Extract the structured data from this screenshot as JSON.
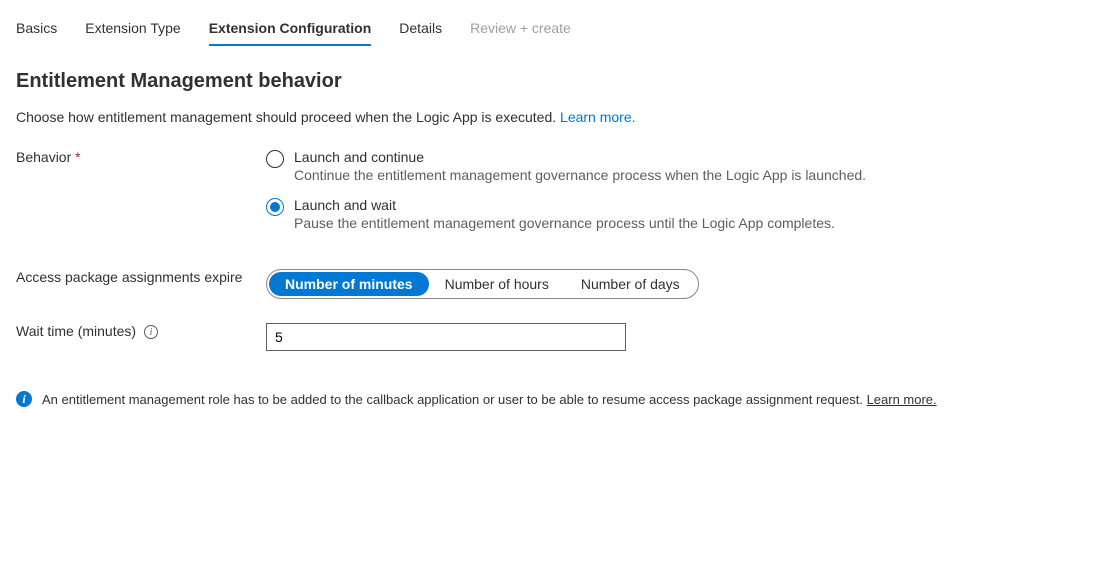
{
  "tabs": {
    "basics": "Basics",
    "extension_type": "Extension Type",
    "extension_configuration": "Extension Configuration",
    "details": "Details",
    "review_create": "Review + create"
  },
  "section_title": "Entitlement Management behavior",
  "description": "Choose how entitlement management should proceed when the Logic App is executed. ",
  "learn_more": "Learn more.",
  "behavior": {
    "label": "Behavior",
    "options": {
      "launch_continue": {
        "label": "Launch and continue",
        "desc": "Continue the entitlement management governance process when the Logic App is launched."
      },
      "launch_wait": {
        "label": "Launch and wait",
        "desc": "Pause the entitlement management governance process until the Logic App completes."
      }
    }
  },
  "expire": {
    "label": "Access package assignments expire",
    "options": {
      "minutes": "Number of minutes",
      "hours": "Number of hours",
      "days": "Number of days"
    }
  },
  "wait_time": {
    "label": "Wait time (minutes)",
    "value": "5"
  },
  "notice": {
    "text": "An entitlement management role has to be added to the callback application or user to be able to resume access package assignment request. ",
    "link": "Learn more."
  }
}
